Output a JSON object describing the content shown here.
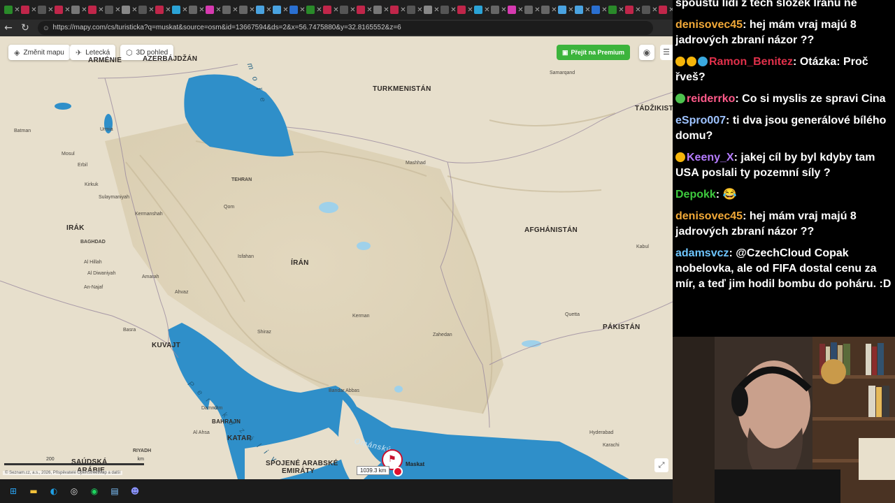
{
  "browser": {
    "url": "https://mapy.com/cs/turisticka?q=muskat&source=osm&id=13667594&ds=2&x=56.7475880&y=32.8165552&z=6",
    "tab_close": "✕",
    "back_icon": "arrow-left-icon",
    "reload_icon": "reload-icon"
  },
  "map": {
    "toolbar": {
      "change_map": "Změnit mapu",
      "aerial": "Letecká",
      "view3d": "3D pohled",
      "premium": "Přejít na Premium"
    },
    "countries": {
      "armenia": "ARMÉNIE",
      "azerbaijan": "AZERBÁJDŽÁN",
      "turkmenistan": "TURKMENISTÁN",
      "tajikistan": "TÁDŽIKISTÁN",
      "iraq": "IRÁK",
      "iran": "ÍRÁN",
      "afghanistan": "AFGHÁNISTÁN",
      "pakistan": "PÁKISTÁN",
      "kuwait": "KUVAJT",
      "bahrain": "BAHRAJN",
      "qatar": "KATAR",
      "uae_1": "SPOJENÉ ARABSKÉ",
      "uae_2": "EMIRÁTY",
      "saudi_1": "SAÚDSKÁ",
      "saudi_2": "ARÁBIE"
    },
    "cities": {
      "tehran": "TEHRAN",
      "mashhad": "Mashhad",
      "qom": "Qom",
      "isfahan": "Isfahan",
      "shiraz": "Shiraz",
      "kerman": "Kerman",
      "zahedan": "Zahedan",
      "baghdad": "BAGHDAD",
      "basra": "Basra",
      "erbil": "Erbil",
      "mosul": "Mosul",
      "kirkuk": "Kirkuk",
      "sulaymaniyah": "Sulaymaniyah",
      "kermanshah": "Kermanshah",
      "ahvaz": "Ahvaz",
      "bandar_abbas": "Bandar Abbas",
      "amarah": "Amarah",
      "al_hillah": "Al Hillah",
      "al_diwaniyah": "Al Diwaniyah",
      "an_najaf": "An-Najaf",
      "batman": "Batman",
      "urmia": "Urmia",
      "samarqand": "Samarqand",
      "kabul": "Kabul",
      "quetta": "Quetta",
      "karachi": "Karachi",
      "hyderabad": "Hyderabad",
      "riyadh": "RIYADH",
      "dammam": "Dammam",
      "al_ahsa": "Al Ahsa",
      "muscat": "Maskat"
    },
    "seas": {
      "caspian": "m o ř e",
      "persian_gulf": "P e r s k ý   z á l i v",
      "gulf_of_oman": "Ománský"
    },
    "distance": "1039.3 km",
    "scale_label": "200",
    "scale_unit": "km",
    "attribution": "© Seznam.cz, a.s., 2026, Přispěvatelé OpenStreetMap a další"
  },
  "chat": [
    {
      "user": "",
      "text": "spoustu lidí z těch složek Íránu ne",
      "color": "#ffffff"
    },
    {
      "user": "denisovec45",
      "text": "hej mám vraj majú 8 jadrových zbraní názor ??",
      "color": "#f2a938"
    },
    {
      "user": "Ramon_Benitez",
      "text": "Otázka: Proč řveš?",
      "color": "#e0304a",
      "badges": [
        "#f5b50a",
        "#f5b50a",
        "#3aa9e0"
      ]
    },
    {
      "user": "reiderrko",
      "text": "Co si myslis ze spravi Cina",
      "color": "#ff5a8a",
      "badges": [
        "#4ec24e"
      ]
    },
    {
      "user": "eSpro007",
      "text": "ti dva jsou generálové bílého domu?",
      "color": "#9ec3ff"
    },
    {
      "user": "Keeny_X",
      "text": "jakej cíl by byl kdyby tam USA poslali ty pozemní síly ?",
      "color": "#b57cff",
      "badges": [
        "#f5b50a"
      ]
    },
    {
      "user": "Depokk",
      "text": "😂",
      "color": "#3ec93e"
    },
    {
      "user": "denisovec45",
      "text": "hej mám vraj majú 8 jadrových zbraní názor ??",
      "color": "#f2a938"
    },
    {
      "user": "adamsvcz",
      "text": "@CzechCloud Copak nobelovka, ale od FIFA dostal cenu za mír, a teď jim hodil bombu do poháru. :D",
      "color": "#6ec6ff"
    }
  ],
  "colors": {
    "land": "#e9e0cc",
    "water": "#2f8fc9",
    "premium": "#3cb43c",
    "pin": "#c8102e"
  }
}
